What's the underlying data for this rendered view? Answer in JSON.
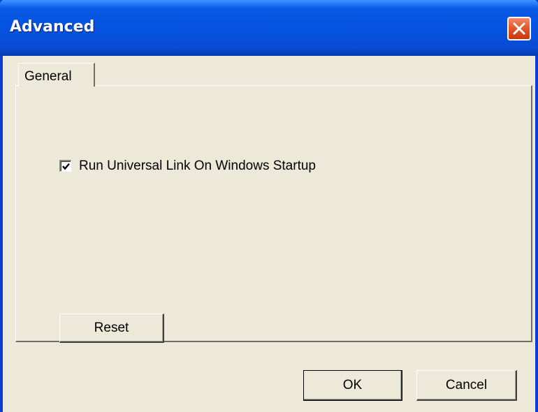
{
  "window": {
    "title": "Advanced",
    "colors": {
      "titlebar": "#0553e0",
      "face": "#ece9d8",
      "close": "#e4592f"
    }
  },
  "tabs": [
    {
      "label": "General",
      "selected": true
    }
  ],
  "general": {
    "startup_checkbox": {
      "label": "Run Universal Link On Windows Startup",
      "checked": true
    },
    "reset_label": "Reset"
  },
  "footer": {
    "ok_label": "OK",
    "cancel_label": "Cancel"
  },
  "icons": {
    "close": "close-icon",
    "check": "checkmark-icon"
  }
}
